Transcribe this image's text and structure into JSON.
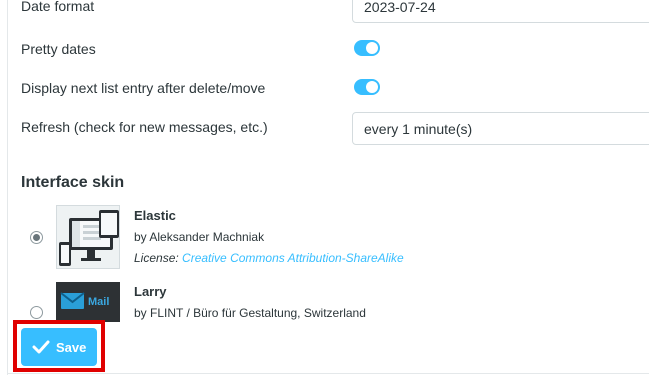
{
  "settings": {
    "date_format": {
      "label": "Date format",
      "value": "2023-07-24"
    },
    "pretty_dates": {
      "label": "Pretty dates",
      "enabled": true
    },
    "next_entry": {
      "label": "Display next list entry after delete/move",
      "enabled": true
    },
    "refresh": {
      "label": "Refresh (check for new messages, etc.)",
      "value": "every 1 minute(s)"
    }
  },
  "interface_skin": {
    "title": "Interface skin",
    "skins": [
      {
        "name": "Elastic",
        "author": "by Aleksander Machniak",
        "license_label": "License:",
        "license_link": "Creative Commons Attribution-ShareAlike",
        "selected": true
      },
      {
        "name": "Larry",
        "author": "by FLINT / Büro für Gestaltung, Switzerland",
        "thumb_text": "Mail",
        "selected": false
      }
    ]
  },
  "footer": {
    "save_label": "Save"
  },
  "colors": {
    "accent": "#37beff",
    "highlight": "#e00000",
    "text": "#2c363a"
  }
}
